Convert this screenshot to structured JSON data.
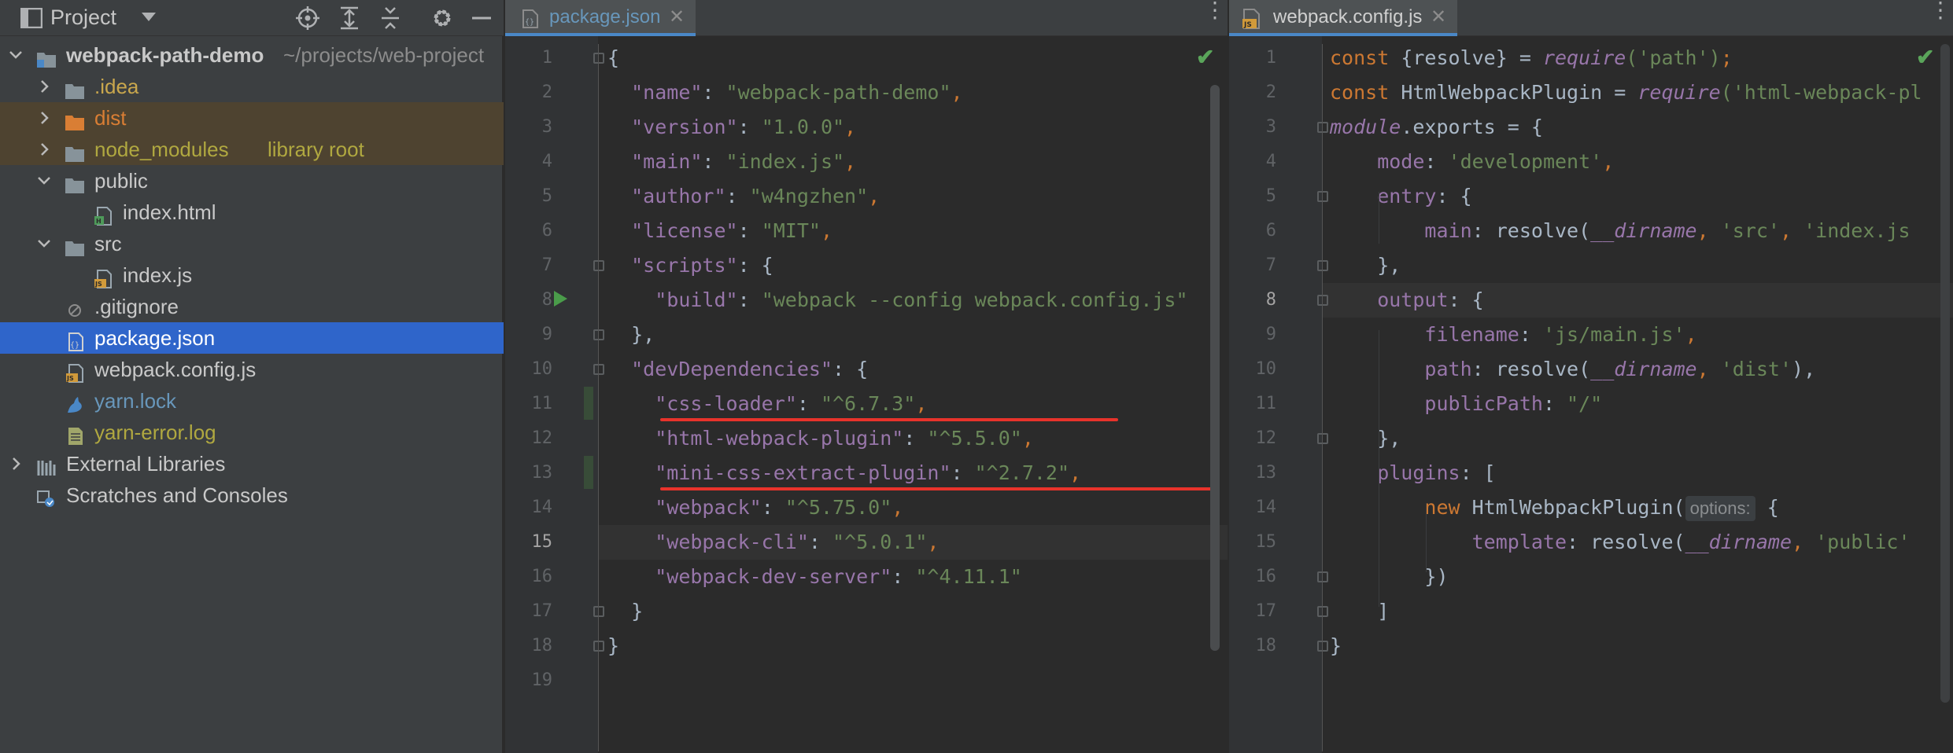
{
  "project_pane": {
    "title": "Project",
    "tree": [
      {
        "label": "webpack-path-demo",
        "suffix": "~/projects/web-project",
        "color": "#c9c9c9",
        "bold": true,
        "icon": "module-folder-icon",
        "arrow": "expanded",
        "level": 0
      },
      {
        "label": ".idea",
        "suffix": "",
        "color": "#c9a74d",
        "icon": "folder-icon",
        "arrow": "collapsed",
        "level": 1
      },
      {
        "label": "dist",
        "suffix": "",
        "color": "#d97e34",
        "icon": "excluded-folder-icon",
        "arrow": "collapsed",
        "level": 1,
        "highlight": "#4e4330"
      },
      {
        "label": "node_modules",
        "suffix": "library root",
        "color": "#b0a840",
        "icon": "folder-icon",
        "arrow": "collapsed",
        "level": 1,
        "highlight": "#4e4330"
      },
      {
        "label": "public",
        "suffix": "",
        "color": "#c9c9c9",
        "icon": "folder-icon",
        "arrow": "expanded",
        "level": 1
      },
      {
        "label": "index.html",
        "suffix": "",
        "color": "#c9c9c9",
        "icon": "html-file-icon",
        "arrow": "",
        "level": 2
      },
      {
        "label": "src",
        "suffix": "",
        "color": "#c9c9c9",
        "icon": "folder-icon",
        "arrow": "expanded",
        "level": 1
      },
      {
        "label": "index.js",
        "suffix": "",
        "color": "#c9c9c9",
        "icon": "js-file-icon",
        "arrow": "",
        "level": 2
      },
      {
        "label": ".gitignore",
        "suffix": "",
        "color": "#c9c9c9",
        "icon": "gitignore-file-icon",
        "arrow": "",
        "level": 1
      },
      {
        "label": "package.json",
        "suffix": "",
        "color": "#ffffff",
        "icon": "json-file-icon",
        "arrow": "",
        "level": 1,
        "selected": true
      },
      {
        "label": "webpack.config.js",
        "suffix": "",
        "color": "#c9c9c9",
        "icon": "js-file-icon",
        "arrow": "",
        "level": 1
      },
      {
        "label": "yarn.lock",
        "suffix": "",
        "color": "#6897bb",
        "icon": "yarn-file-icon",
        "arrow": "",
        "level": 1
      },
      {
        "label": "yarn-error.log",
        "suffix": "",
        "color": "#b0a840",
        "icon": "log-file-icon",
        "arrow": "",
        "level": 1
      },
      {
        "label": "External Libraries",
        "suffix": "",
        "color": "#c9c9c9",
        "icon": "libraries-icon",
        "arrow": "collapsed",
        "level": 0
      },
      {
        "label": "Scratches and Consoles",
        "suffix": "",
        "color": "#c9c9c9",
        "icon": "scratches-icon",
        "arrow": "",
        "level": 0
      }
    ]
  },
  "editor_left": {
    "tab": "package.json",
    "current_line": 15,
    "lines": [
      [
        [
          "{",
          "d"
        ]
      ],
      [
        [
          "  ",
          "d"
        ],
        [
          "\"name\"",
          "key"
        ],
        [
          ": ",
          "d"
        ],
        [
          "\"webpack-path-demo\"",
          "jstr"
        ],
        [
          ",",
          "k"
        ]
      ],
      [
        [
          "  ",
          "d"
        ],
        [
          "\"version\"",
          "key"
        ],
        [
          ": ",
          "d"
        ],
        [
          "\"1.0.0\"",
          "jstr"
        ],
        [
          ",",
          "k"
        ]
      ],
      [
        [
          "  ",
          "d"
        ],
        [
          "\"main\"",
          "key"
        ],
        [
          ": ",
          "d"
        ],
        [
          "\"index.js\"",
          "jstr"
        ],
        [
          ",",
          "k"
        ]
      ],
      [
        [
          "  ",
          "d"
        ],
        [
          "\"author\"",
          "key"
        ],
        [
          ": ",
          "d"
        ],
        [
          "\"w4ngzhen\"",
          "jstr"
        ],
        [
          ",",
          "k"
        ]
      ],
      [
        [
          "  ",
          "d"
        ],
        [
          "\"license\"",
          "key"
        ],
        [
          ": ",
          "d"
        ],
        [
          "\"MIT\"",
          "jstr"
        ],
        [
          ",",
          "k"
        ]
      ],
      [
        [
          "  ",
          "d"
        ],
        [
          "\"scripts\"",
          "key"
        ],
        [
          ": {",
          "d"
        ]
      ],
      [
        [
          "    ",
          "d"
        ],
        [
          "\"build\"",
          "key"
        ],
        [
          ": ",
          "d"
        ],
        [
          "\"webpack --config webpack.config.js\"",
          "jstr"
        ]
      ],
      [
        [
          "  ",
          "d"
        ],
        [
          "},",
          "d"
        ]
      ],
      [
        [
          "  ",
          "d"
        ],
        [
          "\"devDependencies\"",
          "key"
        ],
        [
          ": {",
          "d"
        ]
      ],
      [
        [
          "    ",
          "d"
        ],
        [
          "\"css-loader\"",
          "key"
        ],
        [
          ": ",
          "d"
        ],
        [
          "\"^6.7.3\"",
          "jstr"
        ],
        [
          ",",
          "k"
        ]
      ],
      [
        [
          "    ",
          "d"
        ],
        [
          "\"html-webpack-plugin\"",
          "key"
        ],
        [
          ": ",
          "d"
        ],
        [
          "\"^5.5.0\"",
          "jstr"
        ],
        [
          ",",
          "k"
        ]
      ],
      [
        [
          "    ",
          "d"
        ],
        [
          "\"mini-css-extract-plugin\"",
          "key"
        ],
        [
          ": ",
          "d"
        ],
        [
          "\"^2.7.2\"",
          "jstr"
        ],
        [
          ",",
          "k"
        ]
      ],
      [
        [
          "    ",
          "d"
        ],
        [
          "\"webpack\"",
          "key"
        ],
        [
          ": ",
          "d"
        ],
        [
          "\"^5.75.0\"",
          "jstr"
        ],
        [
          ",",
          "k"
        ]
      ],
      [
        [
          "    ",
          "d"
        ],
        [
          "\"webpack-cli\"",
          "key"
        ],
        [
          ": ",
          "d"
        ],
        [
          "\"^5.0.1\"",
          "jstr"
        ],
        [
          ",",
          "k"
        ]
      ],
      [
        [
          "    ",
          "d"
        ],
        [
          "\"webpack-dev-server\"",
          "key"
        ],
        [
          ": ",
          "d"
        ],
        [
          "\"^4.11.1\"",
          "jstr"
        ]
      ],
      [
        [
          "  ",
          "d"
        ],
        [
          "}",
          "d"
        ]
      ],
      [
        [
          "}",
          "d"
        ]
      ],
      []
    ]
  },
  "editor_right": {
    "tab": "webpack.config.js",
    "current_line": 8,
    "lines": [
      [
        [
          "const ",
          "k"
        ],
        [
          "{resolve} = ",
          "d"
        ],
        [
          "require",
          "i"
        ],
        [
          "('path')",
          "s"
        ],
        [
          ";",
          "k"
        ]
      ],
      [
        [
          "const ",
          "k"
        ],
        [
          "HtmlWebpackPlugin = ",
          "d"
        ],
        [
          "require",
          "i"
        ],
        [
          "('html-webpack-pl",
          "s"
        ]
      ],
      [
        [
          "module",
          "i"
        ],
        [
          ".exports = {",
          "d"
        ]
      ],
      [
        [
          "    mode",
          "p"
        ],
        [
          ": ",
          "d"
        ],
        [
          "'development'",
          "s"
        ],
        [
          ",",
          "k"
        ]
      ],
      [
        [
          "    entry",
          "p"
        ],
        [
          ": {",
          "d"
        ]
      ],
      [
        [
          "        main",
          "p"
        ],
        [
          ": resolve(",
          "d"
        ],
        [
          "__dirname",
          "i"
        ],
        [
          ", ",
          "k"
        ],
        [
          "'src'",
          "s"
        ],
        [
          ", ",
          "k"
        ],
        [
          "'index.js",
          "s"
        ]
      ],
      [
        [
          "    },",
          "d"
        ]
      ],
      [
        [
          "    output",
          "p"
        ],
        [
          ": {",
          "d"
        ]
      ],
      [
        [
          "        filename",
          "p"
        ],
        [
          ": ",
          "d"
        ],
        [
          "'js/main.js'",
          "s"
        ],
        [
          ",",
          "k"
        ]
      ],
      [
        [
          "        path",
          "p"
        ],
        [
          ": resolve(",
          "d"
        ],
        [
          "__dirname",
          "i"
        ],
        [
          ", ",
          "k"
        ],
        [
          "'dist'",
          "s"
        ],
        [
          "),",
          "d"
        ]
      ],
      [
        [
          "        publicPath",
          "p"
        ],
        [
          ": ",
          "d"
        ],
        [
          "\"/\"",
          "s"
        ]
      ],
      [
        [
          "    },",
          "d"
        ]
      ],
      [
        [
          "    plugins",
          "p"
        ],
        [
          ": [",
          "d"
        ]
      ],
      [
        [
          "        ",
          "d"
        ],
        [
          "new ",
          "k"
        ],
        [
          "HtmlWebpackPlugin(",
          "d"
        ],
        [
          "options:",
          "hint"
        ],
        [
          " {",
          "d"
        ]
      ],
      [
        [
          "            template",
          "p"
        ],
        [
          ": resolve(",
          "d"
        ],
        [
          "__dirname",
          "i"
        ],
        [
          ", ",
          "k"
        ],
        [
          "'public'",
          "s"
        ]
      ],
      [
        [
          "        })",
          "d"
        ]
      ],
      [
        [
          "    ]",
          "d"
        ]
      ],
      [
        [
          "}",
          "d"
        ]
      ]
    ]
  },
  "colors": {
    "selection": "#2f65ca",
    "underline": "#e8332b",
    "check": "#5aa55a"
  }
}
